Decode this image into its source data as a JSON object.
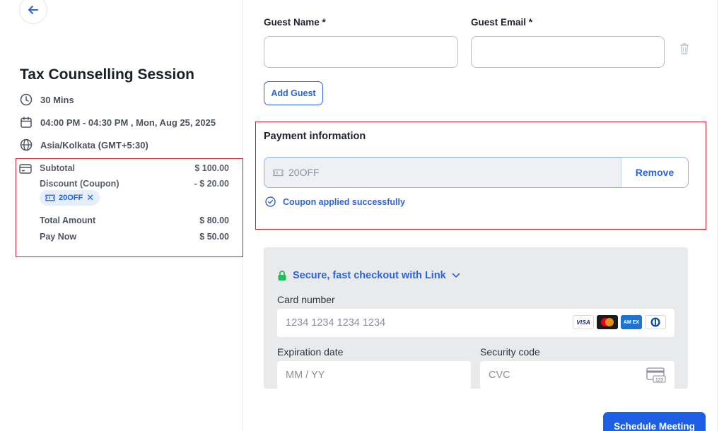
{
  "session": {
    "title": "Tax Counselling Session",
    "duration": "30 Mins",
    "datetime": "04:00 PM - 04:30 PM , Mon, Aug 25, 2025",
    "timezone": "Asia/Kolkata (GMT+5:30)"
  },
  "summary": {
    "subtotal_label": "Subtotal",
    "subtotal_value": "$ 100.00",
    "discount_label": "Discount (Coupon)",
    "discount_value": "- $ 20.00",
    "coupon_chip": "20OFF",
    "coupon_chip_remove": "✕",
    "total_label": "Total Amount",
    "total_value": "$ 80.00",
    "paynow_label": "Pay Now",
    "paynow_value": "$ 50.00"
  },
  "guest": {
    "name_label": "Guest Name *",
    "email_label": "Guest Email *",
    "name_value": "",
    "email_value": "",
    "add_guest_label": "Add Guest"
  },
  "payment": {
    "title": "Payment information",
    "coupon_value": "20OFF",
    "remove_label": "Remove",
    "success_message": "Coupon applied successfully"
  },
  "card_form": {
    "link_text": "Secure, fast checkout with Link",
    "card_number_label": "Card number",
    "card_number_placeholder": "1234 1234 1234 1234",
    "expiration_label": "Expiration date",
    "expiration_placeholder": "MM / YY",
    "security_label": "Security code",
    "security_placeholder": "CVC",
    "brands": [
      "VISA",
      "Mastercard",
      "AMEX",
      "Diners"
    ],
    "amex_text": "AM EX",
    "visa_text": "VISA",
    "cvc_icon_text": "123"
  },
  "actions": {
    "schedule_label": "Schedule Meeting"
  },
  "colors": {
    "accent": "#1d5fe4",
    "highlight_border": "#c8202c",
    "success": "#2c63df"
  },
  "icons": [
    "back-arrow-icon",
    "clock-icon",
    "calendar-icon",
    "globe-icon",
    "credit-card-icon",
    "ticket-icon",
    "trash-icon",
    "check-circle-icon",
    "lock-icon",
    "chevron-down-icon",
    "cvc-card-icon"
  ]
}
